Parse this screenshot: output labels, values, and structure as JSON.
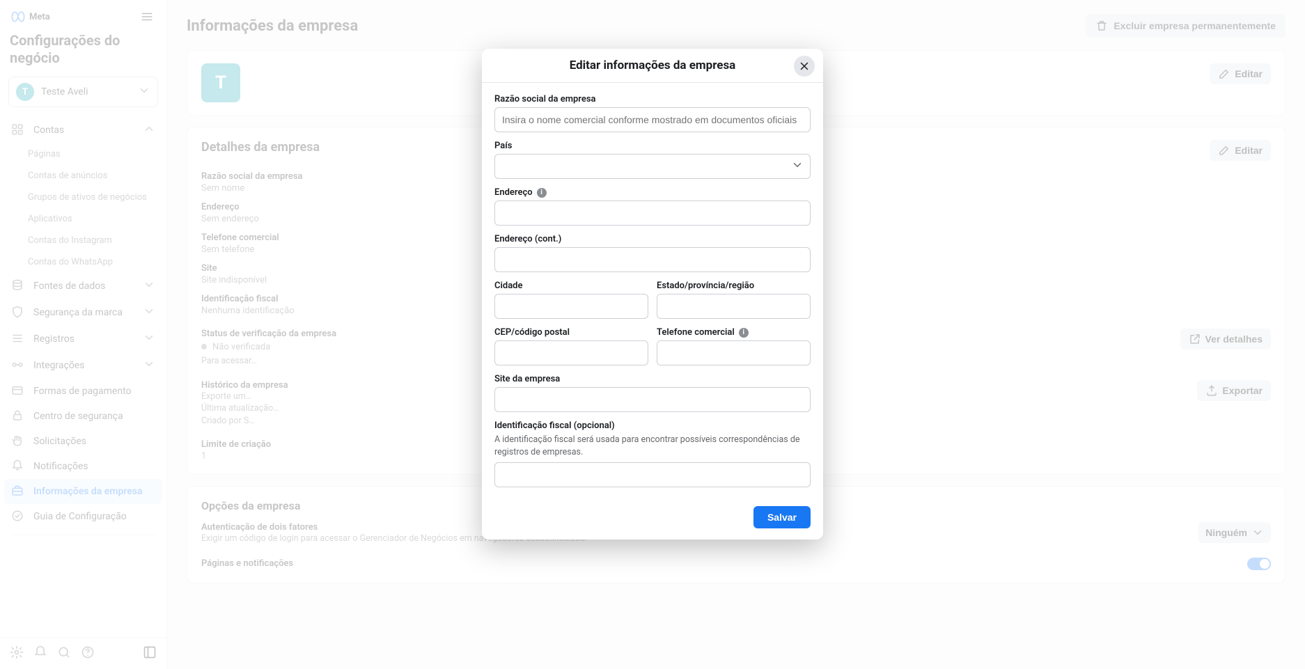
{
  "brand": {
    "word": "Meta"
  },
  "sidebar": {
    "app_title": "Configurações do negócio",
    "account": {
      "initial": "T",
      "name": "Teste Aveli"
    },
    "sections": {
      "contas": {
        "label": "Contas",
        "items": [
          {
            "label": "Páginas"
          },
          {
            "label": "Contas de anúncios"
          },
          {
            "label": "Grupos de ativos de negócios"
          },
          {
            "label": "Aplicativos"
          },
          {
            "label": "Contas do Instagram"
          },
          {
            "label": "Contas do WhatsApp"
          }
        ]
      },
      "fontes": {
        "label": "Fontes de dados"
      },
      "seguranca": {
        "label": "Segurança da marca"
      },
      "registros": {
        "label": "Registros"
      },
      "integracoes": {
        "label": "Integrações"
      },
      "pagamento": {
        "label": "Formas de pagamento"
      },
      "centro": {
        "label": "Centro de segurança"
      },
      "solicitacoes": {
        "label": "Solicitações"
      },
      "notificacoes": {
        "label": "Notificações"
      },
      "info": {
        "label": "Informações da empresa"
      },
      "guia": {
        "label": "Guia de Configuração"
      }
    }
  },
  "page": {
    "title": "Informações da empresa",
    "delete_btn": "Excluir empresa permanentemente",
    "biz_avatar_initial": "T",
    "edit_btn": "Editar"
  },
  "details": {
    "title": "Detalhes da empresa",
    "edit_btn": "Editar",
    "fields": {
      "razao": {
        "label": "Razão social da empresa",
        "value": "Sem nome"
      },
      "endereco": {
        "label": "Endereço",
        "value": "Sem endereço"
      },
      "telefone": {
        "label": "Telefone comercial",
        "value": "Sem telefone"
      },
      "site": {
        "label": "Site",
        "value": "Site indisponível"
      },
      "fiscal": {
        "label": "Identificação fiscal",
        "value": "Nenhuma identificação"
      }
    },
    "verification": {
      "label": "Status de verificação da empresa",
      "status": "Não verificada",
      "note": "Para acessar…",
      "button": "Ver detalhes"
    },
    "history": {
      "label": "Histórico da empresa",
      "line1": "Exporte um…",
      "line2": "Última atualização…",
      "line3": "Criado por S…",
      "button": "Exportar"
    },
    "limit": {
      "label": "Limite de criação",
      "value": "1"
    }
  },
  "options": {
    "title": "Opções da empresa",
    "twofa": {
      "label": "Autenticação de dois fatores",
      "desc": "Exigir um código de login para acessar o Gerenciador de Negócios em navegadores desconhecidos.",
      "selected": "Ninguém"
    },
    "notif": {
      "label": "Páginas e notificações"
    }
  },
  "modal": {
    "title": "Editar informações da empresa",
    "fields": {
      "razao": {
        "label": "Razão social da empresa",
        "placeholder": "Insira o nome comercial conforme mostrado em documentos oficiais"
      },
      "pais": {
        "label": "País"
      },
      "endereco": {
        "label": "Endereço"
      },
      "endereco2": {
        "label": "Endereço (cont.)"
      },
      "cidade": {
        "label": "Cidade"
      },
      "estado": {
        "label": "Estado/província/região"
      },
      "cep": {
        "label": "CEP/código postal"
      },
      "telefone": {
        "label": "Telefone comercial"
      },
      "site": {
        "label": "Site da empresa"
      },
      "fiscal": {
        "label": "Identificação fiscal (opcional)",
        "help": "A identificação fiscal será usada para encontrar possíveis correspondências de registros de empresas."
      }
    },
    "save_btn": "Salvar"
  }
}
